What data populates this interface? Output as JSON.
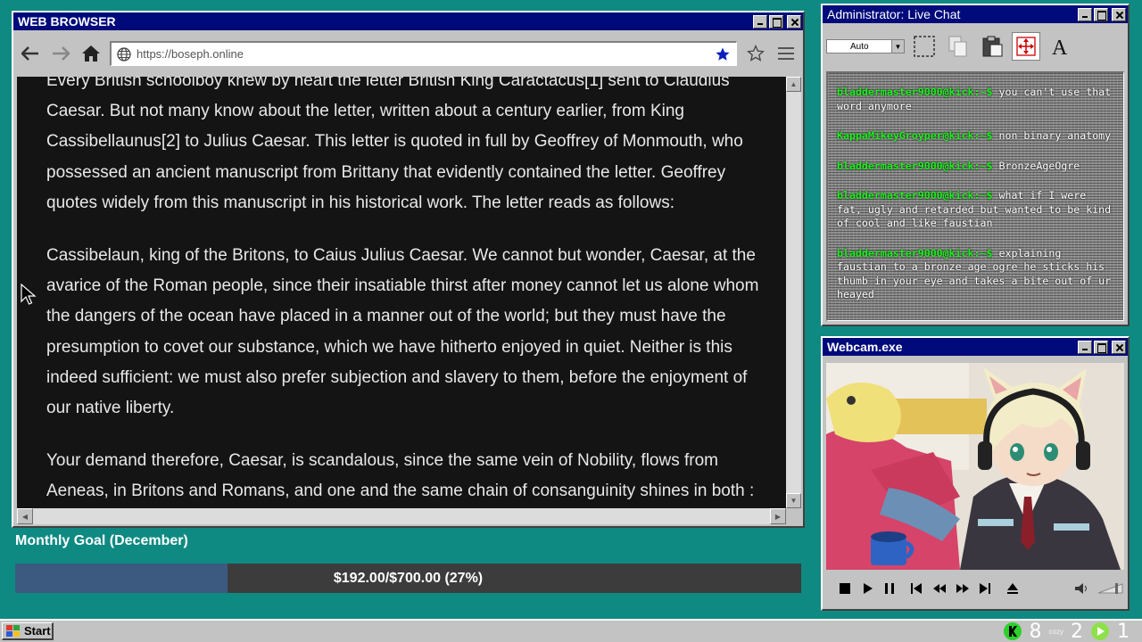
{
  "browser": {
    "title": "WEB BROWSER",
    "url": "https://boseph.online",
    "paragraphs": [
      "Every British schoolboy knew by heart the letter British King Caractacus[1] sent to Claudius Caesar. But not many know about the letter, written about a century earlier, from King Cassibellaunus[2] to Julius Caesar. This letter is quoted in full by Geoffrey of Monmouth, who possessed an ancient manuscript from Brittany that evidently contained the letter. Geoffrey quotes widely from this manuscript in his historical work. The letter reads as follows:",
      "Cassibelaun, king of the Britons, to Caius Julius Caesar. We cannot but wonder, Caesar, at the avarice of the Roman people, since their insatiable thirst after money cannot let us alone whom the dangers of the ocean have placed in a manner out of the world; but they must have the presumption to covet our substance, which we have hitherto enjoyed in quiet. Neither is this indeed sufficient: we must also prefer subjection and slavery to them, before the enjoyment of our native liberty.",
      "Your demand therefore, Caesar, is scandalous, since the same vein of Nobility, flows from Aeneas, in Britons and Romans, and one and the same chain of consanguinity shines in both :"
    ]
  },
  "goal": {
    "label": "Monthly Goal (December)",
    "text": "$192.00/$700.00 (27%)",
    "fraction": 0.27
  },
  "chat": {
    "title": "Administrator: Live Chat",
    "font_size_value": "Auto",
    "messages": [
      {
        "user": "bladdermaster9000@kick:~$",
        "text": "you can't use that word anymore"
      },
      {
        "user": "KappaMikeyGroyper@kick:~$",
        "text": "non binary anatomy"
      },
      {
        "user": "bladdermaster9000@kick:~$",
        "text": "BronzeAgeOgre"
      },
      {
        "user": "bladdermaster9000@kick:~$",
        "text": "what if I were fat, ugly and retarded but wanted to be kind of cool and like faustian"
      },
      {
        "user": "bladdermaster9000@kick:~$",
        "text": "explaining faustian to a bronze age ogre he sticks his thumb in your eye and takes a bite out of ur heayed"
      }
    ]
  },
  "webcam": {
    "title": "Webcam.exe"
  },
  "taskbar": {
    "start_label": "Start",
    "tray_count_1": "8",
    "tray_count_2": "2",
    "tray_count_3": "1",
    "tray_small_label": "cozy"
  },
  "colors": {
    "desktop": "#0e8a82",
    "titlebar": "#000a7a",
    "chat_user": "#1ef01e",
    "goal_fill": "#3c5a80"
  }
}
